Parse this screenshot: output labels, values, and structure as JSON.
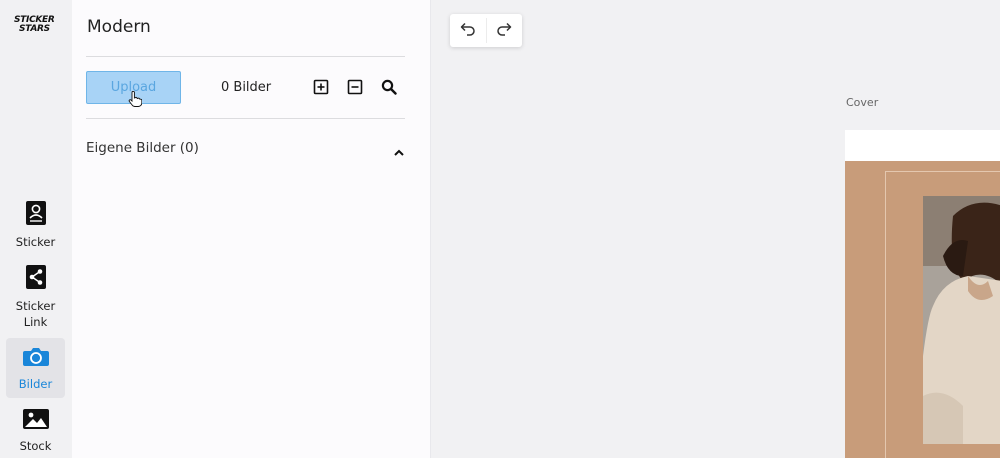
{
  "brand": {
    "line1": "STICKER",
    "line2": "STARS"
  },
  "rail": {
    "items": [
      {
        "label": "Sticker",
        "active": false
      },
      {
        "label": "Sticker\nLink",
        "line1": "Sticker",
        "line2": "Link",
        "active": false
      },
      {
        "label": "Bilder",
        "active": true
      },
      {
        "label": "Stock",
        "active": false
      }
    ]
  },
  "panel": {
    "title": "Modern",
    "upload_label": "Upload",
    "count_text": "0 Bilder",
    "section_label": "Eigene Bilder (0)"
  },
  "canvas": {
    "page_label": "Cover"
  },
  "colors": {
    "accent": "#1a86d9",
    "upload_bg": "#a8d3f6",
    "cover_brown": "#c89c7a"
  },
  "icons": {
    "undo": "undo-icon",
    "redo": "redo-icon",
    "plus": "add-square-icon",
    "minus": "remove-square-icon",
    "search": "search-icon",
    "collapse": "chevron-up-icon"
  }
}
